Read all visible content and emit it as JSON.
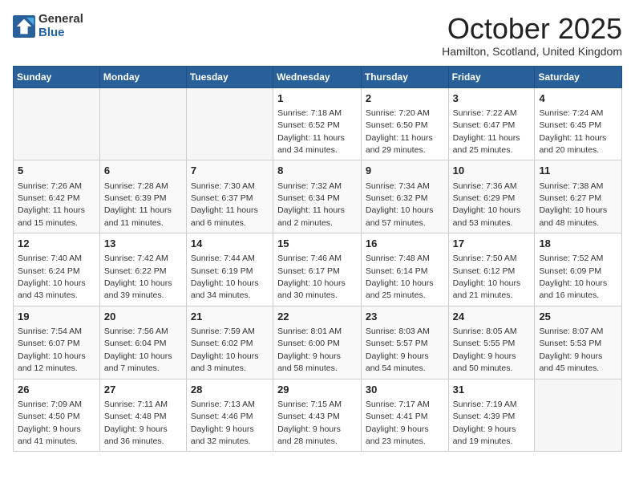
{
  "header": {
    "logo_general": "General",
    "logo_blue": "Blue",
    "month_title": "October 2025",
    "location": "Hamilton, Scotland, United Kingdom"
  },
  "days_of_week": [
    "Sunday",
    "Monday",
    "Tuesday",
    "Wednesday",
    "Thursday",
    "Friday",
    "Saturday"
  ],
  "weeks": [
    [
      {
        "day": "",
        "empty": true
      },
      {
        "day": "",
        "empty": true
      },
      {
        "day": "",
        "empty": true
      },
      {
        "day": "1",
        "sunrise": "7:18 AM",
        "sunset": "6:52 PM",
        "daylight": "11 hours and 34 minutes."
      },
      {
        "day": "2",
        "sunrise": "7:20 AM",
        "sunset": "6:50 PM",
        "daylight": "11 hours and 29 minutes."
      },
      {
        "day": "3",
        "sunrise": "7:22 AM",
        "sunset": "6:47 PM",
        "daylight": "11 hours and 25 minutes."
      },
      {
        "day": "4",
        "sunrise": "7:24 AM",
        "sunset": "6:45 PM",
        "daylight": "11 hours and 20 minutes."
      }
    ],
    [
      {
        "day": "5",
        "sunrise": "7:26 AM",
        "sunset": "6:42 PM",
        "daylight": "11 hours and 15 minutes."
      },
      {
        "day": "6",
        "sunrise": "7:28 AM",
        "sunset": "6:39 PM",
        "daylight": "11 hours and 11 minutes."
      },
      {
        "day": "7",
        "sunrise": "7:30 AM",
        "sunset": "6:37 PM",
        "daylight": "11 hours and 6 minutes."
      },
      {
        "day": "8",
        "sunrise": "7:32 AM",
        "sunset": "6:34 PM",
        "daylight": "11 hours and 2 minutes."
      },
      {
        "day": "9",
        "sunrise": "7:34 AM",
        "sunset": "6:32 PM",
        "daylight": "10 hours and 57 minutes."
      },
      {
        "day": "10",
        "sunrise": "7:36 AM",
        "sunset": "6:29 PM",
        "daylight": "10 hours and 53 minutes."
      },
      {
        "day": "11",
        "sunrise": "7:38 AM",
        "sunset": "6:27 PM",
        "daylight": "10 hours and 48 minutes."
      }
    ],
    [
      {
        "day": "12",
        "sunrise": "7:40 AM",
        "sunset": "6:24 PM",
        "daylight": "10 hours and 43 minutes."
      },
      {
        "day": "13",
        "sunrise": "7:42 AM",
        "sunset": "6:22 PM",
        "daylight": "10 hours and 39 minutes."
      },
      {
        "day": "14",
        "sunrise": "7:44 AM",
        "sunset": "6:19 PM",
        "daylight": "10 hours and 34 minutes."
      },
      {
        "day": "15",
        "sunrise": "7:46 AM",
        "sunset": "6:17 PM",
        "daylight": "10 hours and 30 minutes."
      },
      {
        "day": "16",
        "sunrise": "7:48 AM",
        "sunset": "6:14 PM",
        "daylight": "10 hours and 25 minutes."
      },
      {
        "day": "17",
        "sunrise": "7:50 AM",
        "sunset": "6:12 PM",
        "daylight": "10 hours and 21 minutes."
      },
      {
        "day": "18",
        "sunrise": "7:52 AM",
        "sunset": "6:09 PM",
        "daylight": "10 hours and 16 minutes."
      }
    ],
    [
      {
        "day": "19",
        "sunrise": "7:54 AM",
        "sunset": "6:07 PM",
        "daylight": "10 hours and 12 minutes."
      },
      {
        "day": "20",
        "sunrise": "7:56 AM",
        "sunset": "6:04 PM",
        "daylight": "10 hours and 7 minutes."
      },
      {
        "day": "21",
        "sunrise": "7:59 AM",
        "sunset": "6:02 PM",
        "daylight": "10 hours and 3 minutes."
      },
      {
        "day": "22",
        "sunrise": "8:01 AM",
        "sunset": "6:00 PM",
        "daylight": "9 hours and 58 minutes."
      },
      {
        "day": "23",
        "sunrise": "8:03 AM",
        "sunset": "5:57 PM",
        "daylight": "9 hours and 54 minutes."
      },
      {
        "day": "24",
        "sunrise": "8:05 AM",
        "sunset": "5:55 PM",
        "daylight": "9 hours and 50 minutes."
      },
      {
        "day": "25",
        "sunrise": "8:07 AM",
        "sunset": "5:53 PM",
        "daylight": "9 hours and 45 minutes."
      }
    ],
    [
      {
        "day": "26",
        "sunrise": "7:09 AM",
        "sunset": "4:50 PM",
        "daylight": "9 hours and 41 minutes."
      },
      {
        "day": "27",
        "sunrise": "7:11 AM",
        "sunset": "4:48 PM",
        "daylight": "9 hours and 36 minutes."
      },
      {
        "day": "28",
        "sunrise": "7:13 AM",
        "sunset": "4:46 PM",
        "daylight": "9 hours and 32 minutes."
      },
      {
        "day": "29",
        "sunrise": "7:15 AM",
        "sunset": "4:43 PM",
        "daylight": "9 hours and 28 minutes."
      },
      {
        "day": "30",
        "sunrise": "7:17 AM",
        "sunset": "4:41 PM",
        "daylight": "9 hours and 23 minutes."
      },
      {
        "day": "31",
        "sunrise": "7:19 AM",
        "sunset": "4:39 PM",
        "daylight": "9 hours and 19 minutes."
      },
      {
        "day": "",
        "empty": true
      }
    ]
  ],
  "labels": {
    "sunrise": "Sunrise:",
    "sunset": "Sunset:",
    "daylight": "Daylight:"
  }
}
